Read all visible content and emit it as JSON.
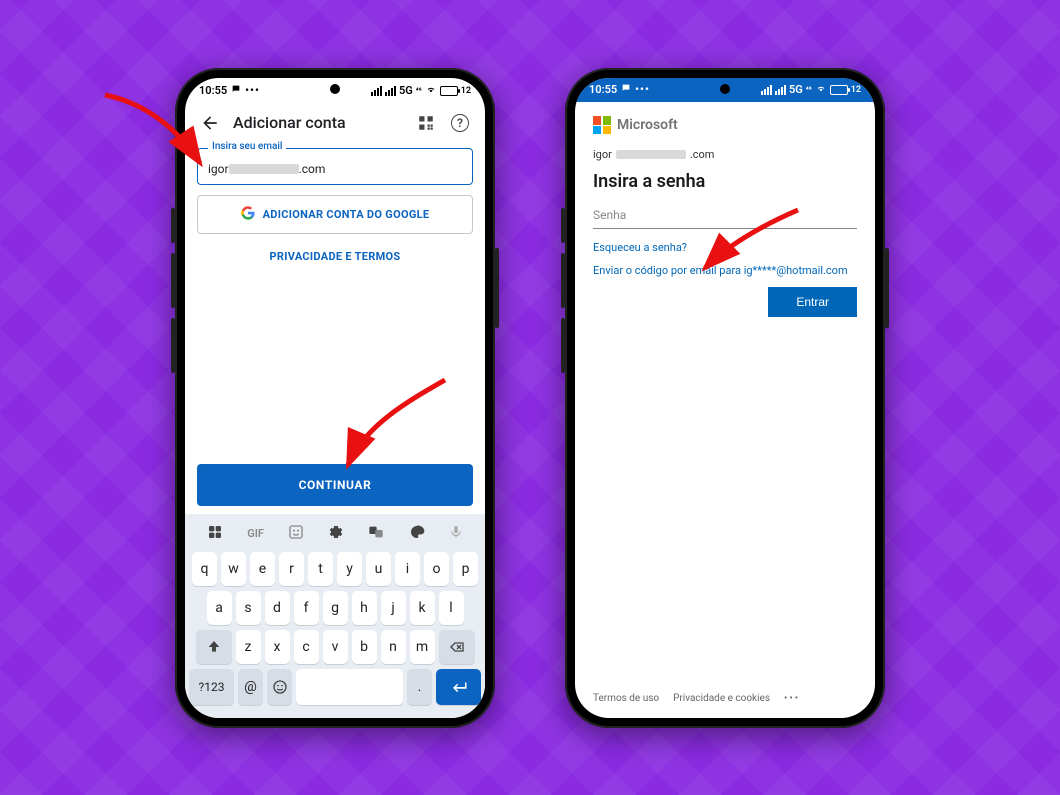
{
  "statusbar": {
    "time": "10:55",
    "network_label": "5G",
    "battery_pct": "12"
  },
  "phone1": {
    "appbar_title": "Adicionar conta",
    "email_label": "Insira seu email",
    "email_prefix": "igor",
    "email_suffix": ".com",
    "google_btn": "ADICIONAR CONTA DO GOOGLE",
    "privacy_link": "PRIVACIDADE E TERMOS",
    "continue_btn": "CONTINUAR",
    "keyboard": {
      "toolbar": {
        "gif": "GIF"
      },
      "row1": [
        "q",
        "w",
        "e",
        "r",
        "t",
        "y",
        "u",
        "i",
        "o",
        "p"
      ],
      "row2": [
        "a",
        "s",
        "d",
        "f",
        "g",
        "h",
        "j",
        "k",
        "l"
      ],
      "row3": [
        "z",
        "x",
        "c",
        "v",
        "b",
        "n",
        "m"
      ],
      "mode_key": "?123",
      "at_key": "@",
      "period_key": "."
    }
  },
  "phone2": {
    "brand": "Microsoft",
    "email_prefix": "igor",
    "email_suffix": ".com",
    "heading": "Insira a senha",
    "password_placeholder": "Senha",
    "forgot_link": "Esqueceu a senha?",
    "send_code": "Enviar o código por email para ig*****@hotmail.com",
    "signin_btn": "Entrar",
    "footer": {
      "terms": "Termos de uso",
      "privacy": "Privacidade e cookies"
    }
  }
}
